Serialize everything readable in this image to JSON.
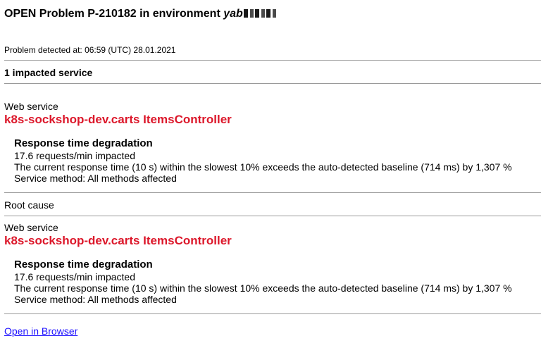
{
  "header": {
    "title_prefix": "OPEN Problem P-210182 in environment ",
    "environment_visible": "yab"
  },
  "detected_text": "Problem detected at: 06:59 (UTC) 28.01.2021",
  "impacted_count_text": "1 impacted service",
  "impacted_service": {
    "type": "Web service",
    "name": "k8s-sockshop-dev.carts ItemsController",
    "event": {
      "title": "Response time degradation",
      "requests": "17.6 requests/min impacted",
      "description": "The current response time (10 s) within the slowest 10% exceeds the auto-detected baseline (714 ms) by 1,307 %",
      "method": "Service method: All methods affected"
    }
  },
  "root_cause_label": "Root cause",
  "root_cause_service": {
    "type": "Web service",
    "name": "k8s-sockshop-dev.carts ItemsController",
    "event": {
      "title": "Response time degradation",
      "requests": "17.6 requests/min impacted",
      "description": "The current response time (10 s) within the slowest 10% exceeds the auto-detected baseline (714 ms) by 1,307 %",
      "method": "Service method: All methods affected"
    }
  },
  "open_link_text": "Open in Browser",
  "colors": {
    "service_name": "#dc172a",
    "link": "#1a0dff",
    "divider": "#9a9a9a"
  }
}
